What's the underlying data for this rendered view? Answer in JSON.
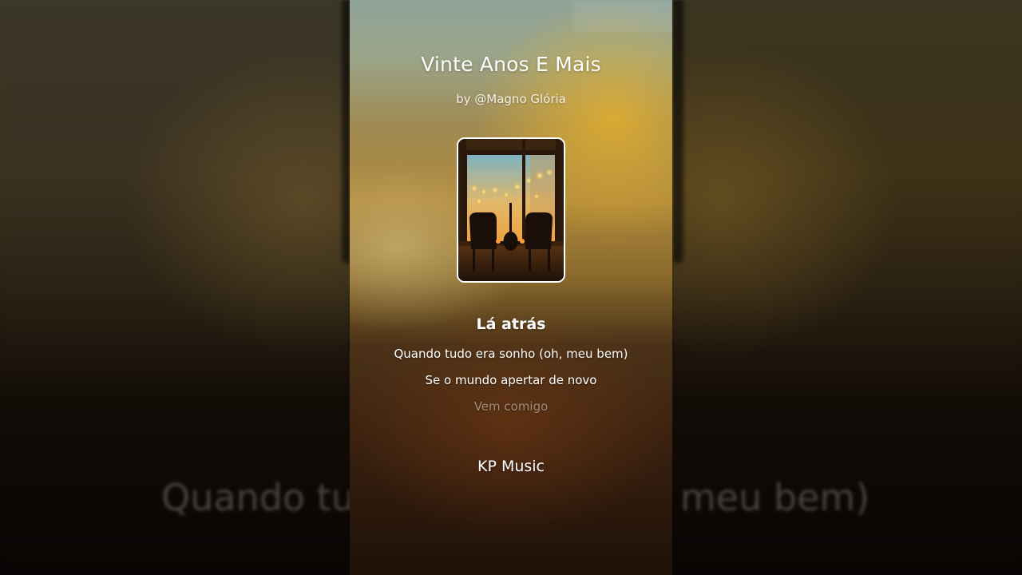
{
  "song": {
    "title": "Vinte Anos E Mais",
    "artist": "by @Magno Glória"
  },
  "cover": {
    "icon": "cover-art-window-chairs-guitar"
  },
  "lyrics": {
    "current": "Lá atrás",
    "line_1": "Quando tudo era sonho (oh, meu bem)",
    "line_2": "Se o mundo apertar de novo",
    "line_3": "Vem comigo"
  },
  "background_lyrics": {
    "left_fragment": "Quando tu",
    "right_fragment": "meu bem)"
  },
  "channel": {
    "name": "KP Music"
  },
  "colors": {
    "accent_warm": "#e8b84a",
    "text": "#ffffff"
  }
}
